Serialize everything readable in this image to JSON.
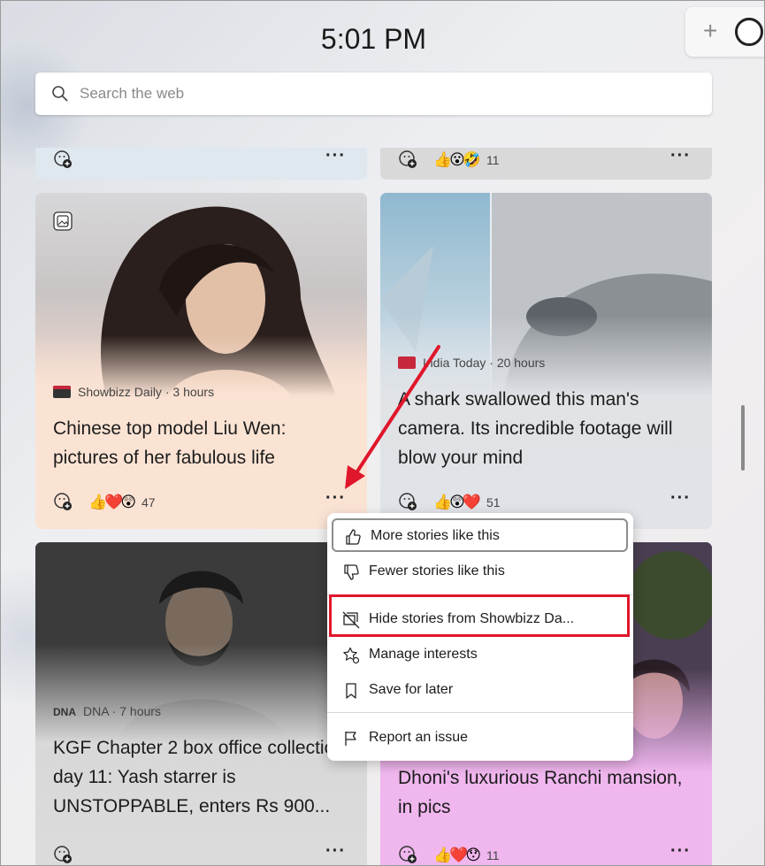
{
  "clock": "5:01 PM",
  "search": {
    "placeholder": "Search the web"
  },
  "top_row": [
    {
      "reactions": "",
      "count": ""
    },
    {
      "reactions": "👍😮🤣",
      "count": "11"
    }
  ],
  "cards": [
    {
      "source": "Showbizz Daily",
      "age": "3 hours",
      "title": "Chinese top model Liu Wen: pictures of her fabulous life",
      "reactions": "👍❤️😲",
      "count": "47"
    },
    {
      "source": "India Today",
      "age": "20 hours",
      "title": "A shark swallowed this man's camera. Its incredible footage will blow your mind",
      "reactions": "👍😲❤️",
      "count": "51"
    },
    {
      "source": "DNA",
      "age": "7 hours",
      "title": "KGF Chapter 2 box office collection day 11: Yash starrer is UNSTOPPABLE, enters Rs 900...",
      "reactions": "",
      "count": ""
    },
    {
      "source": "",
      "age": "",
      "title": "Dhoni's luxurious Ranchi mansion, in pics",
      "reactions": "👍❤️😯",
      "count": "11"
    }
  ],
  "separator": " · ",
  "dna_logo_text": "DNA",
  "menu": {
    "items": [
      {
        "label": "More stories like this",
        "icon": "thumbs-up-icon"
      },
      {
        "label": "Fewer stories like this",
        "icon": "thumbs-down-icon"
      },
      {
        "label": "Hide stories from Showbizz Da...",
        "icon": "hide-stories-icon"
      },
      {
        "label": "Manage interests",
        "icon": "star-settings-icon"
      },
      {
        "label": "Save for later",
        "icon": "bookmark-icon"
      },
      {
        "label": "Report an issue",
        "icon": "flag-icon"
      }
    ]
  },
  "colors": {
    "highlight_box": "#e0162b",
    "arrow": "#e0162b",
    "card_peach": "#fbe3d4",
    "card_pink": "#f0b6ee"
  }
}
